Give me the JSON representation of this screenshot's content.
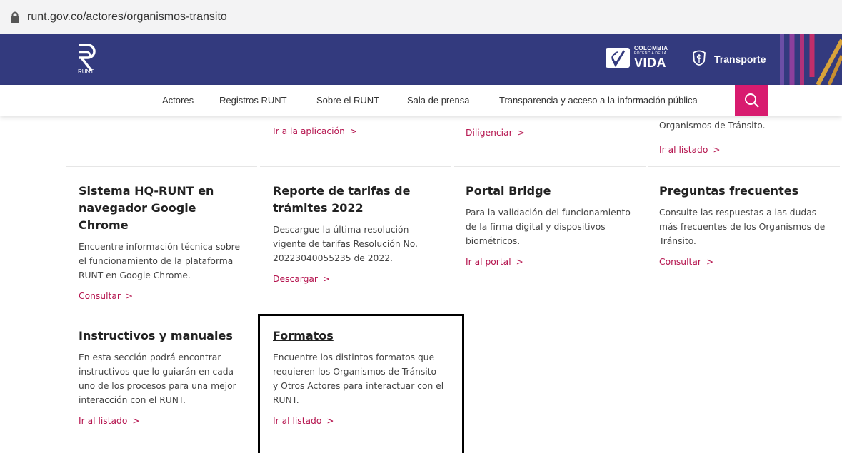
{
  "browser": {
    "url": "runt.gov.co/actores/organismos-transito"
  },
  "header": {
    "logo_text": "RUNT",
    "colombia_line1": "COLOMBIA",
    "colombia_line2": "POTENCIA DE LA",
    "colombia_line3": "VIDA",
    "ministry": "Transporte",
    "colors": {
      "header_bg": "#333a7e",
      "accent": "#d81b6f",
      "link": "#b5154f"
    }
  },
  "nav": {
    "items": [
      {
        "label": "Actores"
      },
      {
        "label": "Registros RUNT"
      },
      {
        "label": "Sobre el RUNT"
      },
      {
        "label": "Sala de prensa"
      },
      {
        "label": "Transparencia y acceso a la información pública"
      }
    ],
    "search_icon": "search-icon"
  },
  "top_row": {
    "link1": "Ir a la aplicación",
    "link2": "Diligenciar",
    "partial_text": "Organismos de Tránsito.",
    "link3": "Ir al listado"
  },
  "cards": [
    {
      "title": "Sistema HQ-RUNT en navegador Google Chrome",
      "desc": "Encuentre información técnica sobre el funcionamiento de la plataforma RUNT en Google Chrome.",
      "link": "Consultar"
    },
    {
      "title": "Reporte de tarifas de trámites 2022",
      "desc": "Descargue la última resolución vigente de tarifas Resolución No. 20223040055235 de 2022.",
      "link": "Descargar"
    },
    {
      "title": "Portal Bridge",
      "desc": "Para la validación del funcionamiento de la firma digital y dispositivos biométricos.",
      "link": "Ir al portal"
    },
    {
      "title": "Preguntas frecuentes",
      "desc": "Consulte las respuestas a las dudas más frecuentes de los Organismos de Tránsito.",
      "link": "Consultar"
    },
    {
      "title": "Instructivos y manuales",
      "desc": "En esta sección podrá encontrar instructivos que lo guiarán en cada uno de los procesos para una mejor interacción con el RUNT.",
      "link": "Ir al listado"
    },
    {
      "title": "Formatos",
      "desc": "Encuentre los distintos formatos que requieren los Organismos de Tránsito y Otros Actores para interactuar con el RUNT.",
      "link": "Ir al listado"
    }
  ]
}
